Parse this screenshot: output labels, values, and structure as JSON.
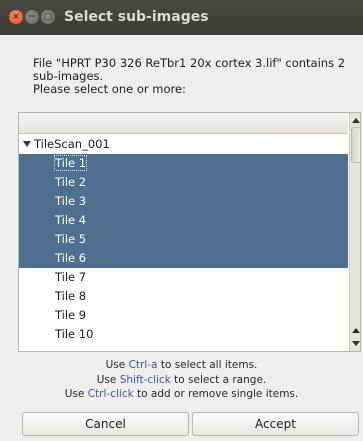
{
  "window": {
    "title": "Select sub-images",
    "close_glyph": "×",
    "min_glyph": "−",
    "max_glyph": "□"
  },
  "message": {
    "line1": "File \"HPRT P30 326 ReTbr1 20x cortex 3.lif\" contains 2",
    "line2": "sub-images.",
    "line3": "Please select one or more:"
  },
  "tree": {
    "parent_label": "TileScan_001",
    "items": [
      {
        "label": "Tile 1",
        "selected": true,
        "focused": true
      },
      {
        "label": "Tile 2",
        "selected": true,
        "focused": false
      },
      {
        "label": "Tile 3",
        "selected": true,
        "focused": false
      },
      {
        "label": "Tile 4",
        "selected": true,
        "focused": false
      },
      {
        "label": "Tile 5",
        "selected": true,
        "focused": false
      },
      {
        "label": "Tile 6",
        "selected": true,
        "focused": false
      },
      {
        "label": "Tile 7",
        "selected": false,
        "focused": false
      },
      {
        "label": "Tile 8",
        "selected": false,
        "focused": false
      },
      {
        "label": "Tile 9",
        "selected": false,
        "focused": false
      },
      {
        "label": "Tile 10",
        "selected": false,
        "focused": false
      }
    ]
  },
  "hints": {
    "line1_pre": "Use ",
    "line1_key": "Ctrl-a",
    "line1_post": " to select all items.",
    "line2_pre": "Use ",
    "line2_key": "Shift-click",
    "line2_post": " to select a range.",
    "line3_pre": "Use ",
    "line3_key": "Ctrl-click",
    "line3_post": " to add or remove single items."
  },
  "buttons": {
    "cancel": "Cancel",
    "accept": "Accept"
  },
  "colors": {
    "selection": "#4e6f8e",
    "hint_key": "#3c55a8",
    "titlebar": "#3b3a36",
    "close_button": "#e2531e"
  }
}
